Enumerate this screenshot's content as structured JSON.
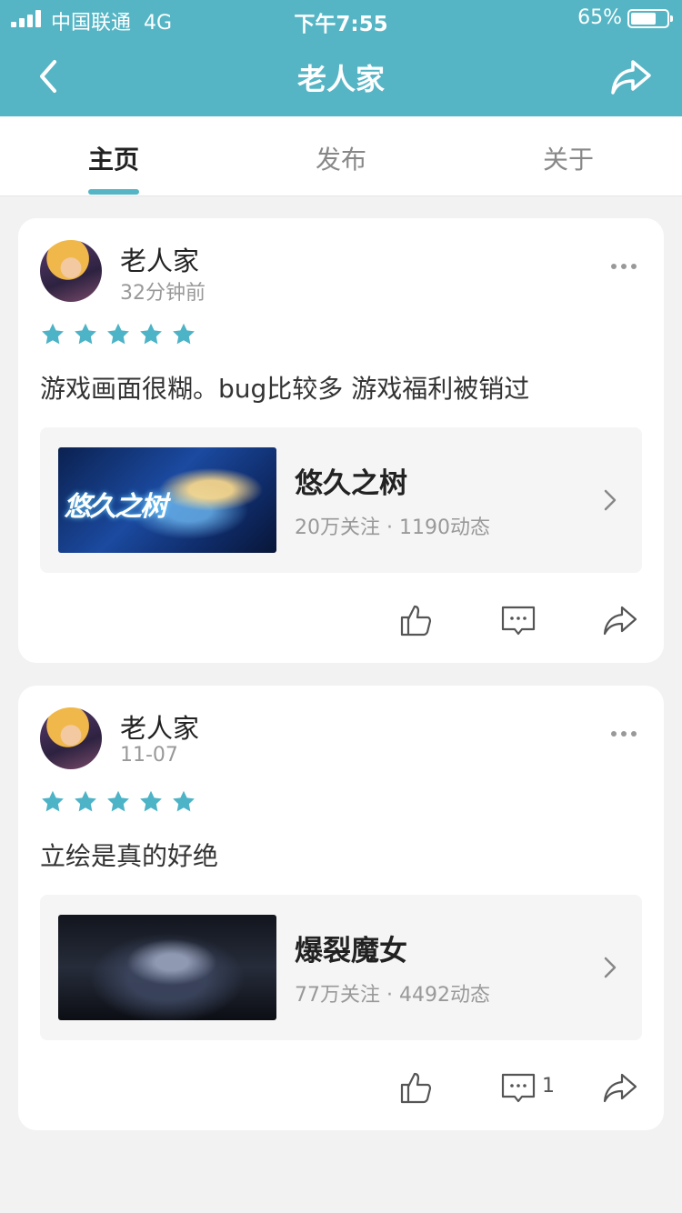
{
  "status_bar": {
    "carrier": "中国联通",
    "network": "4G",
    "time": "下午7:55",
    "battery": "65%",
    "battery_level": 0.65
  },
  "header": {
    "title": "老人家",
    "back_icon": "chevron-left-icon",
    "share_icon": "share-icon"
  },
  "tabs": [
    {
      "label": "主页",
      "active": true
    },
    {
      "label": "发布",
      "active": false
    },
    {
      "label": "关于",
      "active": false
    }
  ],
  "colors": {
    "accent": "#55b5c5",
    "star": "#4db3c6",
    "background": "#f2f2f2"
  },
  "posts": [
    {
      "author": "老人家",
      "time": "32分钟前",
      "rating": 5,
      "content": "游戏画面很糊。bug比较多 游戏福利被销过",
      "game": {
        "name": "悠久之树",
        "stats": "20万关注 · 1190动态",
        "cover_text": "悠久之树"
      },
      "comment_count": ""
    },
    {
      "author": "老人家",
      "time": "11-07",
      "rating": 5,
      "content": "立绘是真的好绝",
      "game": {
        "name": "爆裂魔女",
        "stats": "77万关注 · 4492动态",
        "cover_text": ""
      },
      "comment_count": "1"
    }
  ]
}
